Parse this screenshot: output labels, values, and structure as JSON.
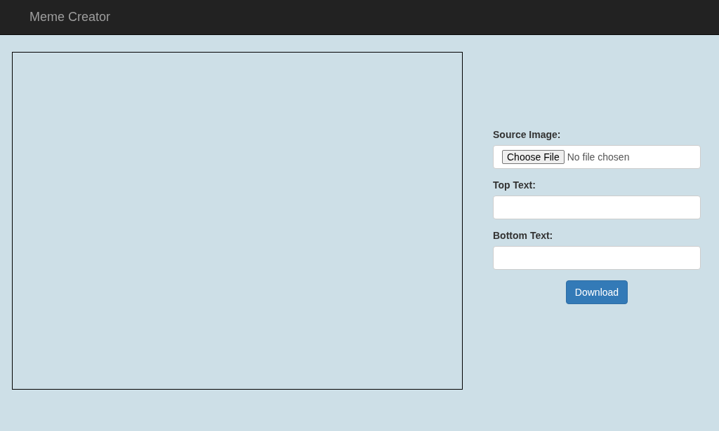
{
  "navbar": {
    "brand": "Meme Creator"
  },
  "form": {
    "fields": [
      {
        "kind": "file",
        "label": "Source Image:",
        "button_label": "Choose File",
        "status": "No file chosen"
      },
      {
        "kind": "text",
        "label": "Top Text:"
      },
      {
        "kind": "text",
        "label": "Bottom Text:"
      }
    ],
    "submit": "Download"
  }
}
